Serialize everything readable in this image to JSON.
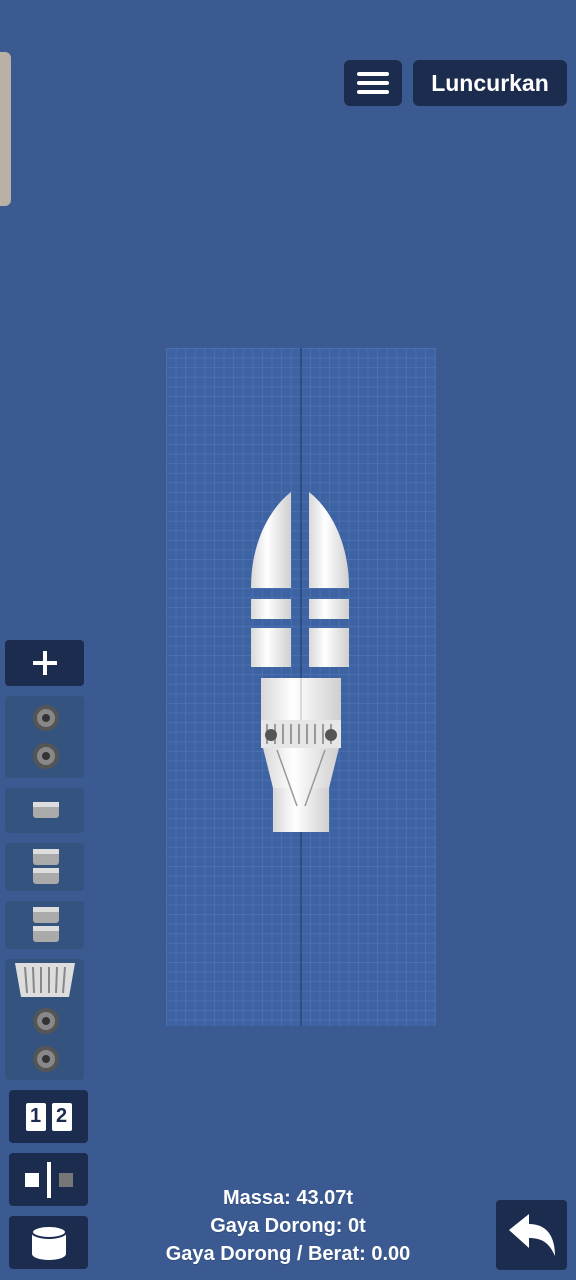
{
  "header": {
    "menu_icon": "hamburger-menu-icon",
    "launch_label": "Luncurkan"
  },
  "sidebar": {
    "add_icon": "plus-icon",
    "stage_items": [
      {
        "name": "stage-1",
        "icons": [
          "rcs-thruster-icon",
          "rcs-thruster-icon"
        ]
      },
      {
        "name": "stage-2",
        "icons": [
          "fuel-tank-icon"
        ]
      },
      {
        "name": "stage-3",
        "icons": [
          "fuel-tank-icon",
          "fuel-tank-icon"
        ]
      },
      {
        "name": "stage-4",
        "icons": [
          "fuel-tank-icon",
          "fuel-tank-icon"
        ]
      },
      {
        "name": "stage-5",
        "icons": [
          "engine-icon",
          "rcs-thruster-icon",
          "rcs-thruster-icon"
        ]
      }
    ],
    "tools": [
      {
        "name": "stage-order-tool",
        "icon": "stage-numbers-icon",
        "label1": "1",
        "label2": "2"
      },
      {
        "name": "symmetry-tool",
        "icon": "symmetry-icon"
      },
      {
        "name": "part-shape-tool",
        "icon": "cylinder-icon"
      }
    ]
  },
  "stats": {
    "mass": "Massa: 43.07t",
    "thrust": "Gaya Dorong: 0t",
    "twr": "Gaya Dorong / Berat: 0.00"
  },
  "footer": {
    "undo_icon": "undo-arrow-icon"
  },
  "colors": {
    "background": "#3a5a91",
    "button": "#1b2c4f",
    "grid": "#3d63a3"
  }
}
